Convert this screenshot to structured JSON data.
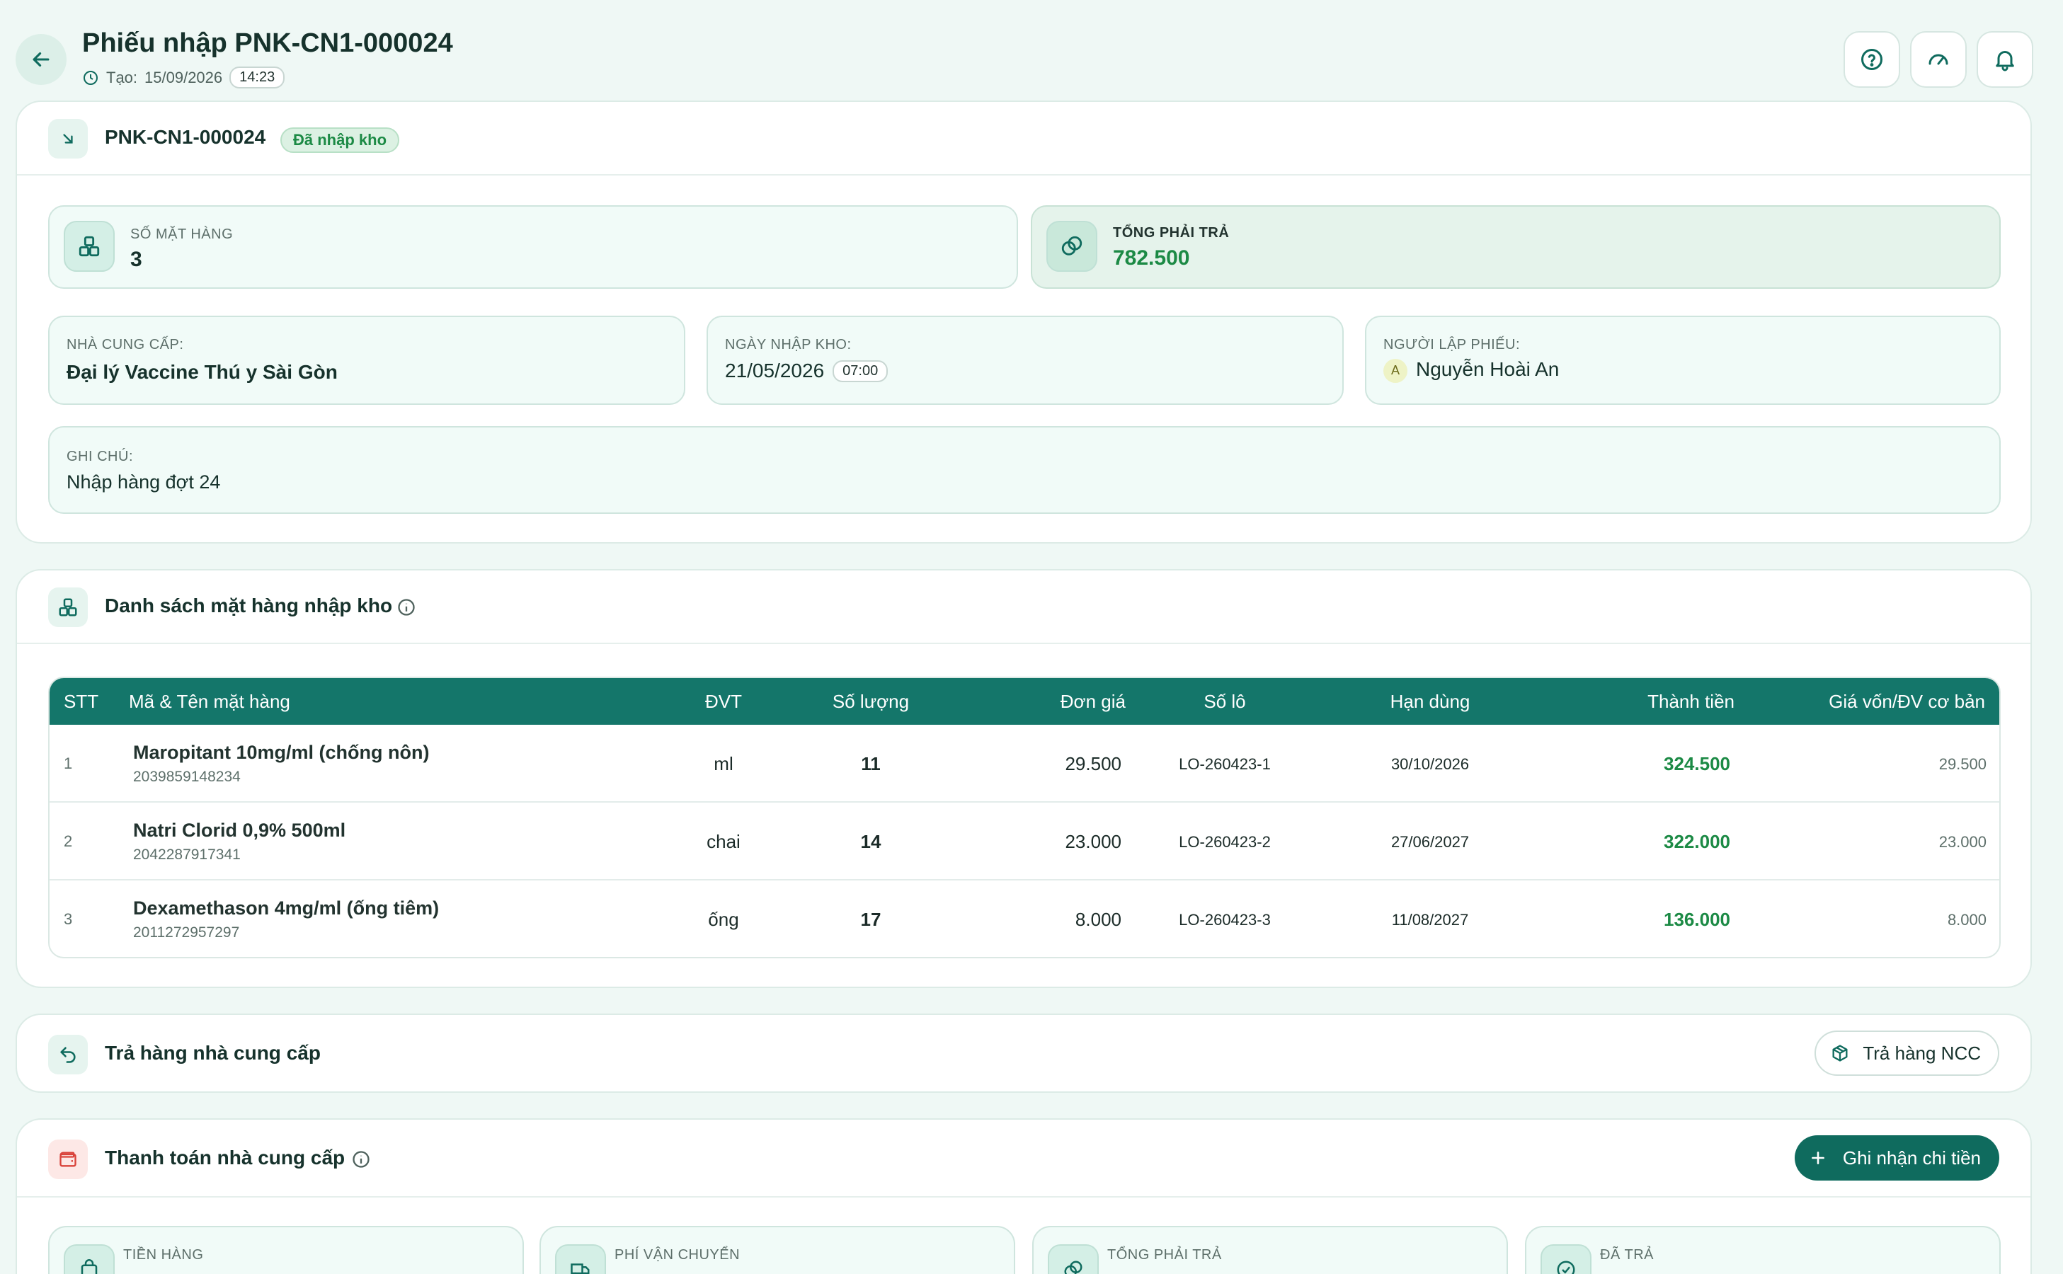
{
  "header": {
    "title": "Phiếu nhập PNK-CN1-000024",
    "created_label": "Tạo:",
    "created_date": "15/09/2026",
    "created_time": "14:23",
    "buttons": [
      "help-circle-icon",
      "gauge-icon",
      "bell-icon"
    ]
  },
  "receipt": {
    "code": "PNK-CN1-000024",
    "status": "Đã nhập kho",
    "item_count_label": "SỐ MẶT HÀNG",
    "item_count": "3",
    "total_label": "TỔNG PHẢI TRẢ",
    "total": "782.500",
    "supplier_label": "NHÀ CUNG CẤP:",
    "supplier": "Đại lý Vaccine Thú y Sài Gòn",
    "date_label": "NGÀY NHẬP KHO:",
    "date": "21/05/2026",
    "time": "07:00",
    "creator_label": "NGƯỜI LẬP PHIẾU:",
    "creator_initial": "A",
    "creator": "Nguyễn Hoài An",
    "note_label": "GHI CHÚ:",
    "note": "Nhập hàng đợt 24"
  },
  "items_section": {
    "title": "Danh sách mặt hàng nhập kho",
    "columns": [
      "STT",
      "Mã & Tên mặt hàng",
      "ĐVT",
      "Số lượng",
      "Đơn giá",
      "Số lô",
      "Hạn dùng",
      "Thành tiền",
      "Giá vốn/ĐV cơ bản"
    ],
    "rows": [
      {
        "stt": "1",
        "name": "Maropitant 10mg/ml (chống nôn)",
        "code": "2039859148234",
        "unit": "ml",
        "qty": "11",
        "price": "29.500",
        "lot": "LO-260423-1",
        "expiry": "30/10/2026",
        "amount": "324.500",
        "cost": "29.500"
      },
      {
        "stt": "2",
        "name": "Natri Clorid 0,9% 500ml",
        "code": "2042287917341",
        "unit": "chai",
        "qty": "14",
        "price": "23.000",
        "lot": "LO-260423-2",
        "expiry": "27/06/2027",
        "amount": "322.000",
        "cost": "23.000"
      },
      {
        "stt": "3",
        "name": "Dexamethason 4mg/ml (ống tiêm)",
        "code": "2011272957297",
        "unit": "ống",
        "qty": "17",
        "price": "8.000",
        "lot": "LO-260423-3",
        "expiry": "11/08/2027",
        "amount": "136.000",
        "cost": "8.000"
      }
    ]
  },
  "return_section": {
    "title": "Trả hàng nhà cung cấp",
    "button": "Trả hàng NCC"
  },
  "payment_section": {
    "title": "Thanh toán nhà cung cấp",
    "button": "Ghi nhận chi tiền",
    "stats": [
      "TIỀN HÀNG",
      "PHÍ VẬN CHUYỂN",
      "TỔNG PHẢI TRẢ",
      "ĐÃ TRẢ"
    ]
  },
  "colors": {
    "accent": "#0f6b5e",
    "table_header": "#14766a",
    "amount_green": "#1c8a45",
    "background": "#eff8f5",
    "payment_icon": "#d9433b"
  }
}
